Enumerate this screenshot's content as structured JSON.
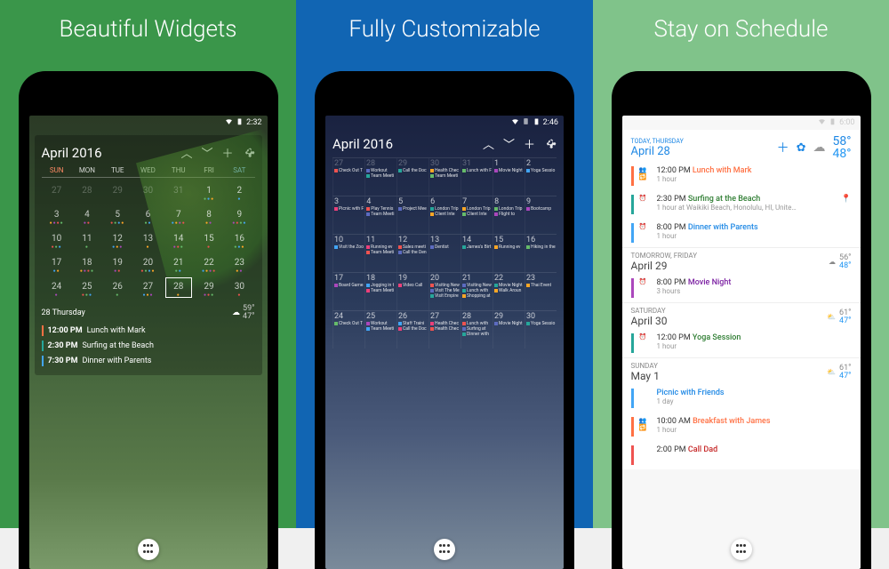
{
  "panel1": {
    "headline": "Beautiful Widgets",
    "status_time": "2:32",
    "month": "April 2016",
    "dow": [
      "SUN",
      "MON",
      "TUE",
      "WED",
      "THU",
      "FRI",
      "SAT"
    ],
    "weeks": [
      [
        {
          "n": "27",
          "dim": true
        },
        {
          "n": "28",
          "dim": true
        },
        {
          "n": "29",
          "dim": true
        },
        {
          "n": "30",
          "dim": true
        },
        {
          "n": "31",
          "dim": true
        },
        {
          "n": "1"
        },
        {
          "n": "2"
        }
      ],
      [
        {
          "n": "3"
        },
        {
          "n": "4"
        },
        {
          "n": "5"
        },
        {
          "n": "6"
        },
        {
          "n": "7"
        },
        {
          "n": "8"
        },
        {
          "n": "9"
        }
      ],
      [
        {
          "n": "10"
        },
        {
          "n": "11"
        },
        {
          "n": "12"
        },
        {
          "n": "13"
        },
        {
          "n": "14"
        },
        {
          "n": "15"
        },
        {
          "n": "16"
        }
      ],
      [
        {
          "n": "17"
        },
        {
          "n": "18"
        },
        {
          "n": "19"
        },
        {
          "n": "20"
        },
        {
          "n": "21"
        },
        {
          "n": "22"
        },
        {
          "n": "23"
        }
      ],
      [
        {
          "n": "24"
        },
        {
          "n": "25"
        },
        {
          "n": "26"
        },
        {
          "n": "27"
        },
        {
          "n": "28",
          "today": true
        },
        {
          "n": "29"
        },
        {
          "n": "30"
        }
      ]
    ],
    "agenda_date": "28 Thursday",
    "temp_hi": "59°",
    "temp_lo": "47°",
    "agenda": [
      {
        "time": "12:00 PM",
        "title": "Lunch with Mark",
        "color": "#ff7043"
      },
      {
        "time": "2:30 PM",
        "title": "Surfing at the Beach",
        "color": "#26a69a"
      },
      {
        "time": "7:30 PM",
        "title": "Dinner with Parents",
        "color": "#42a5f5"
      }
    ]
  },
  "panel2": {
    "headline": "Fully Customizable",
    "status_time": "2:46",
    "month": "April 2016",
    "rows": [
      {
        "start": 27,
        "dim_prev": 5,
        "events": [
          [
            "Check Out T"
          ],
          [
            "Workout",
            "Team Meeti"
          ],
          [
            "Call the Doc"
          ],
          [
            "Health Chec",
            "Team Meeti"
          ],
          [
            "Lunch with F"
          ],
          [
            "Movie Night"
          ],
          [
            "Yoga Sessio"
          ]
        ]
      },
      {
        "start": 3,
        "events": [
          [
            "Picnic with F"
          ],
          [
            "Play Tennis",
            "Team Meeti"
          ],
          [
            "Project Mee"
          ],
          [
            "London Trip",
            "Client Inte"
          ],
          [
            "London Trip",
            "Client Inte"
          ],
          [
            "London Trip",
            "Flight to"
          ],
          [
            "Bootcamp"
          ]
        ]
      },
      {
        "start": 10,
        "events": [
          [
            "Visit the Zoo"
          ],
          [
            "Running ev",
            "Team Meeti"
          ],
          [
            "Sales meeti",
            "Call the Den"
          ],
          [
            "Dentist"
          ],
          [
            "James's Birt"
          ],
          [
            "Running ev"
          ],
          [
            "Hiking in the"
          ]
        ]
      },
      {
        "start": 17,
        "events": [
          [
            "Board Game"
          ],
          [
            "Jogging in t",
            "Team Meeti"
          ],
          [
            "Video Call"
          ],
          [
            "Visiting New",
            "Visit The Me",
            "Visit Empire"
          ],
          [
            "Visiting New",
            "Lunch with",
            "Shopping at"
          ],
          [
            "Movie Night",
            "Walk Aroun"
          ],
          [
            "Thai Event"
          ]
        ]
      },
      {
        "start": 24,
        "events": [
          [
            "Check Out T"
          ],
          [
            "Workout",
            "Team Meeti"
          ],
          [
            "Staff Traini",
            "Call the Doc"
          ],
          [
            "Health Chec",
            "Health Chec"
          ],
          [
            "Lunch with",
            "Surfing at",
            "Dinner with"
          ],
          [
            "Movie Night"
          ],
          [
            "Yoga Sessio"
          ]
        ]
      }
    ],
    "colors": [
      "#ef5350",
      "#5c6bc0",
      "#26a69a",
      "#ffa726",
      "#66bb6a",
      "#ab47bc",
      "#42a5f5",
      "#ec407a"
    ]
  },
  "panel3": {
    "headline": "Stay on Schedule",
    "status_time": "6:00",
    "today_label": "TODAY, THURSDAY",
    "today_date": "April 28",
    "today_hi": "58°",
    "today_lo": "48°",
    "sections": [
      {
        "label": "TODAY, THURSDAY",
        "date": "April 28",
        "hi": "58°",
        "lo": "48°",
        "current": true,
        "items": [
          {
            "time": "12:00 PM",
            "title": "Lunch with Mark",
            "sub": "1 hour",
            "color": "#ff7043",
            "title_color": "#ff7043",
            "icons": [
              "users",
              "repeat"
            ]
          },
          {
            "time": "2:30 PM",
            "title": "Surfing at the Beach",
            "sub": "1 hour at Waikiki Beach, Honolulu, HI, Unite…",
            "color": "#26a69a",
            "title_color": "#2e7d32",
            "pin": true,
            "icons": [
              "alarm"
            ]
          },
          {
            "time": "8:00 PM",
            "title": "Dinner with Parents",
            "sub": "1 hour",
            "color": "#42a5f5",
            "title_color": "#1e88e5",
            "icons": [
              "alarm"
            ]
          }
        ]
      },
      {
        "label": "TOMORROW, FRIDAY",
        "date": "April 29",
        "hi": "56°",
        "lo": "48°",
        "items": [
          {
            "time": "8:00 PM",
            "title": "Movie Night",
            "sub": "3 hours",
            "color": "#ab47bc",
            "title_color": "#7b1fa2",
            "icons": [
              "alarm"
            ]
          }
        ]
      },
      {
        "label": "SATURDAY",
        "date": "April 30",
        "hi": "61°",
        "lo": "47°",
        "items": [
          {
            "time": "12:00 PM",
            "title": "Yoga Session",
            "sub": "1 hour",
            "color": "#26a69a",
            "title_color": "#2e7d32",
            "icons": [
              "alarm"
            ]
          }
        ]
      },
      {
        "label": "SUNDAY",
        "date": "May 1",
        "hi": "61°",
        "lo": "47°",
        "items": [
          {
            "time": "",
            "title": "Picnic with Friends",
            "sub": "1 day",
            "color": "#42a5f5",
            "title_color": "#1e88e5",
            "icons": []
          },
          {
            "time": "10:00 AM",
            "title": "Breakfast with James",
            "sub": "1 hour",
            "color": "#ff7043",
            "title_color": "#ff7043",
            "icons": [
              "users",
              "repeat"
            ]
          },
          {
            "time": "2:00 PM",
            "title": "Call Dad",
            "sub": "",
            "color": "#ef5350",
            "title_color": "#c62828",
            "icons": []
          }
        ]
      }
    ]
  }
}
